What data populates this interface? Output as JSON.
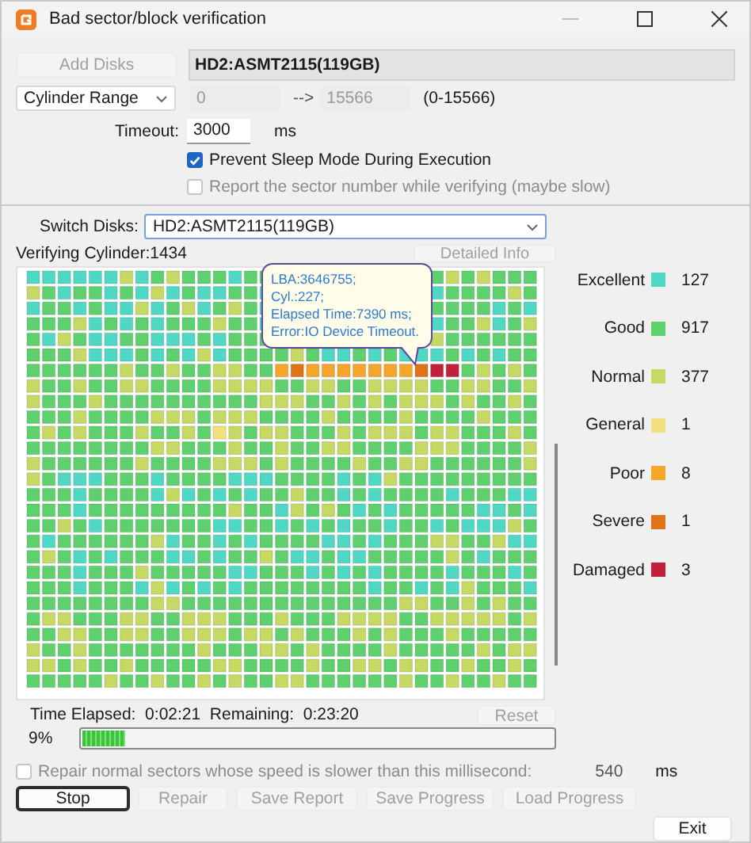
{
  "window": {
    "title": "Bad sector/block verification"
  },
  "disk_row": {
    "add_button": {
      "label": "Add Disks",
      "disabled": true
    },
    "disk_name": "HD2:ASMT2115(119GB)"
  },
  "range_row": {
    "mode": "Cylinder Range",
    "from": "0",
    "arrow": "-->",
    "to": "15566",
    "range": "(0-15566)",
    "disabled": true
  },
  "timeout": {
    "label": "Timeout:",
    "value": "3000",
    "unit": "ms"
  },
  "options": [
    {
      "label": "Prevent Sleep Mode During Execution",
      "checked": true,
      "disabled": false
    },
    {
      "label": "Report the sector number while verifying (maybe slow)",
      "checked": false,
      "disabled": true
    }
  ],
  "switch_disks": {
    "label": "Switch Disks:",
    "value": "HD2:ASMT2115(119GB)"
  },
  "verifying": "Verifying Cylinder:1434",
  "detail_button": {
    "label": "Detailed Info",
    "disabled": true
  },
  "tooltip": {
    "lines": [
      "LBA:3646755;",
      "Cyl.:227;",
      "Elapsed Time:7390 ms;",
      "Error:IO Device Timeout."
    ]
  },
  "legend": [
    {
      "label": "Excellent",
      "color": "#4fd8c4",
      "count": "127"
    },
    {
      "label": "Good",
      "color": "#5fd06e",
      "count": "917"
    },
    {
      "label": "Normal",
      "color": "#c6d962",
      "count": "377"
    },
    {
      "label": "General",
      "color": "#f3df7c",
      "count": "1"
    },
    {
      "label": "Poor",
      "color": "#f5a62a",
      "count": "8"
    },
    {
      "label": "Severe",
      "color": "#e0731a",
      "count": "1"
    },
    {
      "label": "Damaged",
      "color": "#c2213c",
      "count": "3"
    }
  ],
  "timing": "Time Elapsed:  0:02:21  Remaining:  0:23:20",
  "reset_button": {
    "label": "Reset",
    "disabled": true
  },
  "progress": {
    "reading": "9%",
    "level": 0.09
  },
  "repair_option": {
    "label": "Repair normal sectors whose speed is slower than this millisecond:",
    "checked": false,
    "value": "540",
    "unit": "ms"
  },
  "actions": [
    {
      "label": "Stop",
      "disabled": false,
      "focused": true
    },
    {
      "label": "Repair",
      "disabled": true,
      "focused": false
    },
    {
      "label": "Save Report",
      "disabled": true,
      "focused": false
    },
    {
      "label": "Save Progress",
      "disabled": true,
      "focused": false
    },
    {
      "label": "Load Progress",
      "disabled": true,
      "focused": false
    }
  ],
  "exit_button": {
    "label": "Exit",
    "disabled": false
  }
}
